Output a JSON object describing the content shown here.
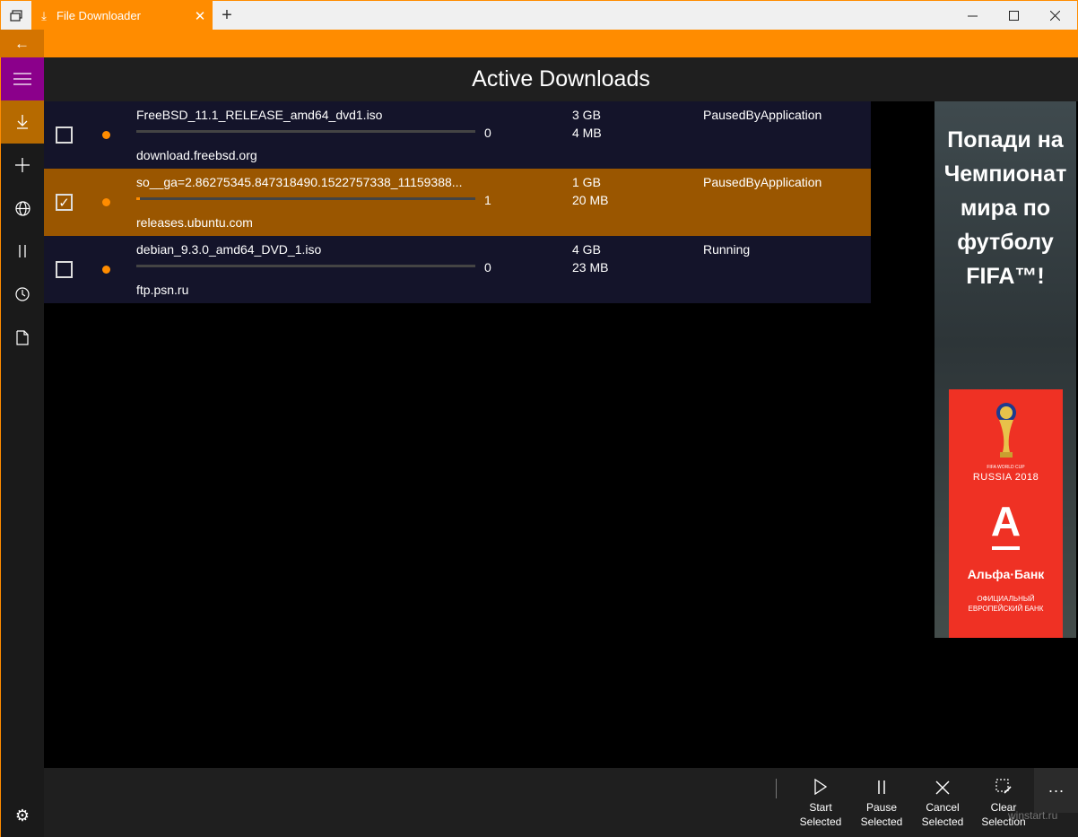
{
  "window": {
    "tab_title": "File Downloader",
    "new_tab_symbol": "+",
    "accent_color": "#ff8c00"
  },
  "header": {
    "title": "Active Downloads"
  },
  "downloads": [
    {
      "name": "FreeBSD_11.1_RELEASE_amd64_dvd1.iso",
      "host": "download.freebsd.org",
      "percent": "0",
      "progress_fraction": 0.0,
      "size": "3 GB",
      "speed": "4 MB",
      "status": "PausedByApplication",
      "checked": false
    },
    {
      "name": "so__ga=2.86275345.847318490.1522757338_11159388...",
      "host": "releases.ubuntu.com",
      "percent": "1",
      "progress_fraction": 0.01,
      "size": "1 GB",
      "speed": "20 MB",
      "status": "PausedByApplication",
      "checked": true
    },
    {
      "name": "debian_9.3.0_amd64_DVD_1.iso",
      "host": "ftp.psn.ru",
      "percent": "0",
      "progress_fraction": 0.0,
      "size": "4 GB",
      "speed": "23 MB",
      "status": "Running",
      "checked": false
    }
  ],
  "ad": {
    "headline": "Попади на Чемпионат мира по футболу FIFA™!",
    "cup_small": "FIFA WORLD CUP",
    "cup_name": "RUSSIA 2018",
    "bank_letter": "А",
    "bank_name": "Альфа·Банк",
    "bank_sub": "ОФИЦИАЛЬНЫЙ ЕВРОПЕЙСКИЙ БАНК"
  },
  "commands": {
    "start_label": "Start Selected",
    "pause_label": "Pause Selected",
    "cancel_label": "Cancel Selected",
    "clear_label": "Clear Selection",
    "more_symbol": "···"
  },
  "watermark": "winstart.ru"
}
